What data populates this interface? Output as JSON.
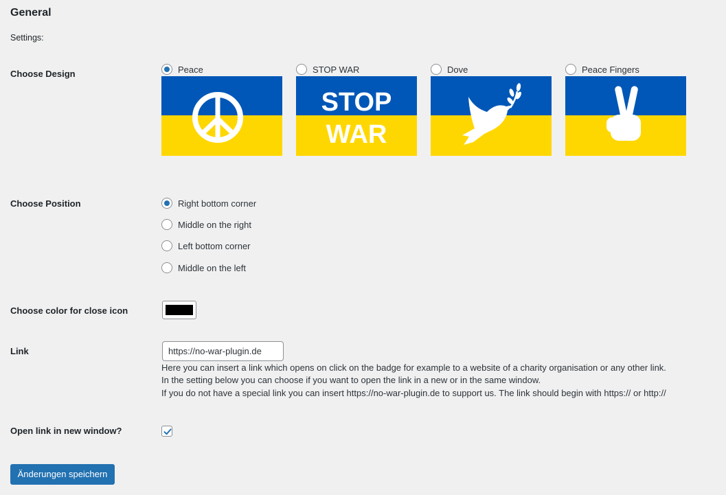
{
  "header": {
    "title": "General",
    "subtitle": "Settings:"
  },
  "design": {
    "label": "Choose Design",
    "options": [
      {
        "label": "Peace",
        "selected": true,
        "icon": "peace-sign-icon"
      },
      {
        "label": "STOP WAR",
        "selected": false,
        "icon": "stop-war-text",
        "text_line1": "STOP",
        "text_line2": "WAR"
      },
      {
        "label": "Dove",
        "selected": false,
        "icon": "dove-icon"
      },
      {
        "label": "Peace Fingers",
        "selected": false,
        "icon": "peace-fingers-icon"
      }
    ],
    "flag_colors": {
      "top": "#0057b7",
      "bottom": "#ffd700"
    }
  },
  "position": {
    "label": "Choose Position",
    "options": [
      {
        "label": "Right bottom corner",
        "selected": true
      },
      {
        "label": "Middle on the right",
        "selected": false
      },
      {
        "label": "Left bottom corner",
        "selected": false
      },
      {
        "label": "Middle on the left",
        "selected": false
      }
    ]
  },
  "close_color": {
    "label": "Choose color for close icon",
    "value": "#000000"
  },
  "link": {
    "label": "Link",
    "value": "https://no-war-plugin.de",
    "description": [
      "Here you can insert a link which opens on click on the badge for example to a website of a charity organisation or any other link.",
      "In the setting below you can choose if you want to open the link in a new or in the same window.",
      "If you do not have a special link you can insert https://no-war-plugin.de to support us. The link should begin with https:// or http://"
    ]
  },
  "new_window": {
    "label": "Open link in new window?",
    "checked": true
  },
  "save_button": {
    "label": "Änderungen speichern"
  },
  "accent_color": "#2271b1"
}
